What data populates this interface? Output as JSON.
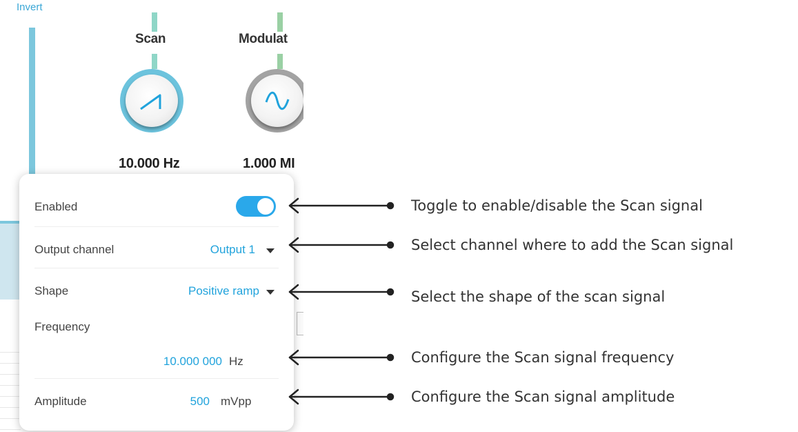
{
  "background": {
    "invert_label": "Invert",
    "knobs": [
      {
        "title": "Scan",
        "value": "10.000 Hz",
        "icon": "ramp-icon",
        "color": "#6cc3dd"
      },
      {
        "title": "Modulat",
        "value": "1.000 MI",
        "icon": "sine-icon",
        "color": "#a3a3a3"
      }
    ]
  },
  "popup": {
    "enabled": {
      "label": "Enabled",
      "state": true
    },
    "output_channel": {
      "label": "Output channel",
      "value": "Output 1"
    },
    "shape": {
      "label": "Shape",
      "value": "Positive ramp"
    },
    "frequency": {
      "label": "Frequency",
      "value": "10.000 000",
      "unit": "Hz"
    },
    "amplitude": {
      "label": "Amplitude",
      "value": "500",
      "unit": "mVpp"
    }
  },
  "annotations": [
    "Toggle to enable/disable the Scan signal",
    "Select channel where to add the Scan signal",
    "Select the shape of the scan signal",
    "Configure the Scan signal frequency",
    "Configure the Scan signal amplitude"
  ],
  "colors": {
    "accent": "#21a3dc",
    "toggle_on": "#2aa8ea",
    "scan_ring": "#6cc3dd",
    "mod_ring": "#a3a3a3"
  }
}
